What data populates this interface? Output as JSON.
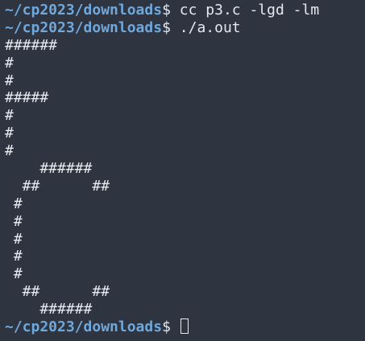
{
  "terminal": {
    "prompt": "~/cp2023/downloads",
    "prompt_symbol": "$",
    "commands": [
      "cc p3.c -lgd -lm",
      "./a.out"
    ],
    "output_lines": [
      "######",
      "#",
      "#",
      "#####",
      "#",
      "#",
      "#",
      "    ######",
      "  ##      ##",
      " #",
      " #",
      " #",
      " #",
      " #",
      "  ##      ##",
      "    ######"
    ],
    "current_input": ""
  },
  "colors": {
    "background": "#2e3440",
    "prompt": "#6fa8dc",
    "text": "#e5e9f0"
  }
}
